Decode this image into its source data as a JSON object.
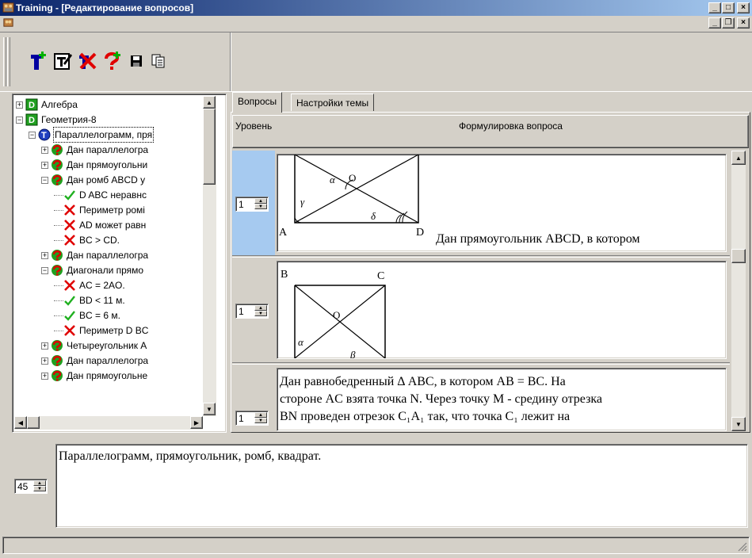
{
  "window": {
    "title": "Training - [Редактирование вопросов]",
    "app_icon": "app-icon",
    "buttons": {
      "minimize": "_",
      "maximize": "□",
      "close": "×"
    }
  },
  "mdi": {
    "doc_icon": "document-icon",
    "buttons": {
      "minimize": "_",
      "restore": "❐",
      "close": "×"
    }
  },
  "toolbar": {
    "buttons": [
      {
        "name": "add-topic-button",
        "icon": "add-topic-icon"
      },
      {
        "name": "edit-button",
        "icon": "edit-icon"
      },
      {
        "name": "delete-button",
        "icon": "delete-icon"
      },
      {
        "name": "add-question-button",
        "icon": "add-question-icon"
      },
      {
        "name": "save-button",
        "icon": "save-icon"
      },
      {
        "name": "copy-button",
        "icon": "copy-icon"
      }
    ]
  },
  "tree": {
    "items": [
      {
        "label": "Алгебра",
        "level": 0,
        "toggle": "+",
        "icon": "topic-icon"
      },
      {
        "label": "Геометрия-8",
        "level": 0,
        "toggle": "−",
        "icon": "topic-icon"
      },
      {
        "label": "Параллелограмм, пря",
        "level": 1,
        "toggle": "−",
        "icon": "subtopic-icon",
        "selected": true
      },
      {
        "label": "Дан параллелогра",
        "level": 2,
        "toggle": "+",
        "icon": "question-icon"
      },
      {
        "label": "Дан прямоугольни",
        "level": 2,
        "toggle": "+",
        "icon": "question-icon"
      },
      {
        "label": "Дан ромб ABCD у",
        "level": 2,
        "toggle": "−",
        "icon": "question-icon"
      },
      {
        "label": "D ABC неравнс",
        "level": 3,
        "icon": "check-icon"
      },
      {
        "label": "Периметр ромі",
        "level": 3,
        "icon": "cross-icon"
      },
      {
        "label": "AD может равн",
        "level": 3,
        "icon": "cross-icon"
      },
      {
        "label": "BC > CD.",
        "level": 3,
        "icon": "cross-icon"
      },
      {
        "label": "Дан параллелогра",
        "level": 2,
        "toggle": "+",
        "icon": "question-icon"
      },
      {
        "label": "Диагонали прямо",
        "level": 2,
        "toggle": "−",
        "icon": "question-icon"
      },
      {
        "label": "AC = 2AO.",
        "level": 3,
        "icon": "cross-icon"
      },
      {
        "label": "BD < 11 м.",
        "level": 3,
        "icon": "check-icon"
      },
      {
        "label": "BC = 6 м.",
        "level": 3,
        "icon": "check-icon"
      },
      {
        "label": "Периметр D BC",
        "level": 3,
        "icon": "cross-icon"
      },
      {
        "label": "Четыреугольник А",
        "level": 2,
        "toggle": "+",
        "icon": "question-icon"
      },
      {
        "label": "Дан параллелогра",
        "level": 2,
        "toggle": "+",
        "icon": "question-icon"
      },
      {
        "label": "Дан прямоугольне",
        "level": 2,
        "toggle": "+",
        "icon": "question-icon"
      }
    ]
  },
  "tabs": [
    {
      "label": "Вопросы",
      "active": true
    },
    {
      "label": "Настройки темы",
      "active": false
    }
  ],
  "grid": {
    "columns": {
      "level": "Уровень",
      "question": "Формулировка вопроса"
    },
    "rows": [
      {
        "level": "1",
        "selected": true,
        "text": "Дан прямоугольник ABCD, в котором",
        "figure": {
          "labels": {
            "a": "A",
            "d": "D",
            "o": "O",
            "alpha": "α",
            "gamma": "γ",
            "delta": "δ"
          }
        }
      },
      {
        "level": "1",
        "selected": false,
        "figure": {
          "labels": {
            "b": "B",
            "c": "C",
            "o": "O",
            "alpha": "α",
            "beta": "β"
          }
        }
      },
      {
        "level": "1",
        "selected": false,
        "lines": [
          "Дан равнобедренный Δ ABC, в котором AB = BC. На",
          "стороне AC взята точка N. Через точку M - средину отрезка",
          "BN проведен отрезок C₁A₁ так, что точка C₁ лежит на"
        ]
      }
    ]
  },
  "topic": {
    "number": "45",
    "description": "Параллелограмм, прямоугольник, ромб, квадрат."
  },
  "status": {
    "text": ""
  }
}
